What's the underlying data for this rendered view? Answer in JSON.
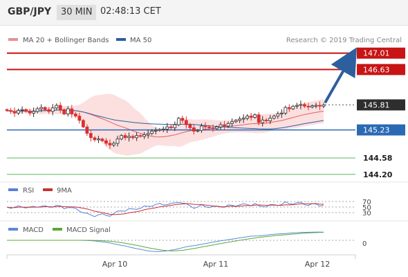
{
  "header": {
    "symbol": "GBP/JPY",
    "timeframe": "30 MIN",
    "time": "02:48:13 CET"
  },
  "colors": {
    "resistance": "#c81414",
    "pivot": "#2a6ab4",
    "support": "#5cb85c",
    "ma20": "#e06060",
    "ma50": "#2a5fa0",
    "bollinger_fill": "#fbd9d9",
    "arrow": "#2d5f9e",
    "candle_up": "#2a2a2a",
    "candle_down": "#d83030",
    "rsi": "#5a7fd8",
    "rsi_ma": "#c83030",
    "macd": "#5a8ad8",
    "macd_signal": "#5aa83a"
  },
  "chart_data": {
    "type": "candlestick",
    "price_panel": {
      "ylim": [
        144.1,
        147.15
      ],
      "legend": [
        {
          "name": "MA 20 + Bollinger Bands",
          "icon": "ma20-swatch"
        },
        {
          "name": "MA 50",
          "icon": "ma50-swatch"
        }
      ],
      "credit": "Research © 2019 Trading Central",
      "levels": [
        {
          "value": 147.01,
          "label": "147.01",
          "kind": "resistance"
        },
        {
          "value": 146.63,
          "label": "146.63",
          "kind": "resistance"
        },
        {
          "value": 145.81,
          "label": "145.81",
          "kind": "last"
        },
        {
          "value": 145.23,
          "label": "145.23",
          "kind": "pivot"
        },
        {
          "value": 144.58,
          "label": "144.58",
          "kind": "support"
        },
        {
          "value": 144.2,
          "label": "144.20",
          "kind": "support"
        }
      ],
      "arrow": {
        "from": 145.81,
        "to": 147.01
      },
      "close": [
        145.68,
        145.66,
        145.62,
        145.68,
        145.7,
        145.66,
        145.62,
        145.66,
        145.72,
        145.75,
        145.7,
        145.66,
        145.74,
        145.8,
        145.7,
        145.6,
        145.72,
        145.6,
        145.55,
        145.45,
        145.3,
        145.15,
        145.05,
        145.0,
        145.02,
        144.98,
        144.92,
        144.88,
        144.92,
        145.02,
        145.1,
        145.05,
        145.08,
        145.05,
        145.1,
        145.08,
        145.12,
        145.15,
        145.2,
        145.22,
        145.24,
        145.25,
        145.3,
        145.28,
        145.35,
        145.5,
        145.45,
        145.35,
        145.28,
        145.2,
        145.22,
        145.32,
        145.3,
        145.28,
        145.26,
        145.3,
        145.35,
        145.32,
        145.38,
        145.42,
        145.45,
        145.48,
        145.5,
        145.55,
        145.52,
        145.58,
        145.4,
        145.46,
        145.44,
        145.5,
        145.55,
        145.6,
        145.62,
        145.75,
        145.72,
        145.78,
        145.8,
        145.82,
        145.78,
        145.76,
        145.79,
        145.8,
        145.78,
        145.81
      ]
    },
    "rsi_panel": {
      "legend": [
        {
          "name": "RSI",
          "icon": "rsi-swatch"
        },
        {
          "name": "9MA",
          "icon": "rsi-ma-swatch"
        }
      ],
      "ticks": [
        70,
        50,
        30
      ]
    },
    "macd_panel": {
      "legend": [
        {
          "name": "MACD",
          "icon": "macd-swatch"
        },
        {
          "name": "MACD Signal",
          "icon": "macd-signal-swatch"
        }
      ],
      "ticks": [
        0
      ]
    },
    "x_ticks": [
      "Apr 10",
      "Apr 11",
      "Apr 12"
    ]
  }
}
